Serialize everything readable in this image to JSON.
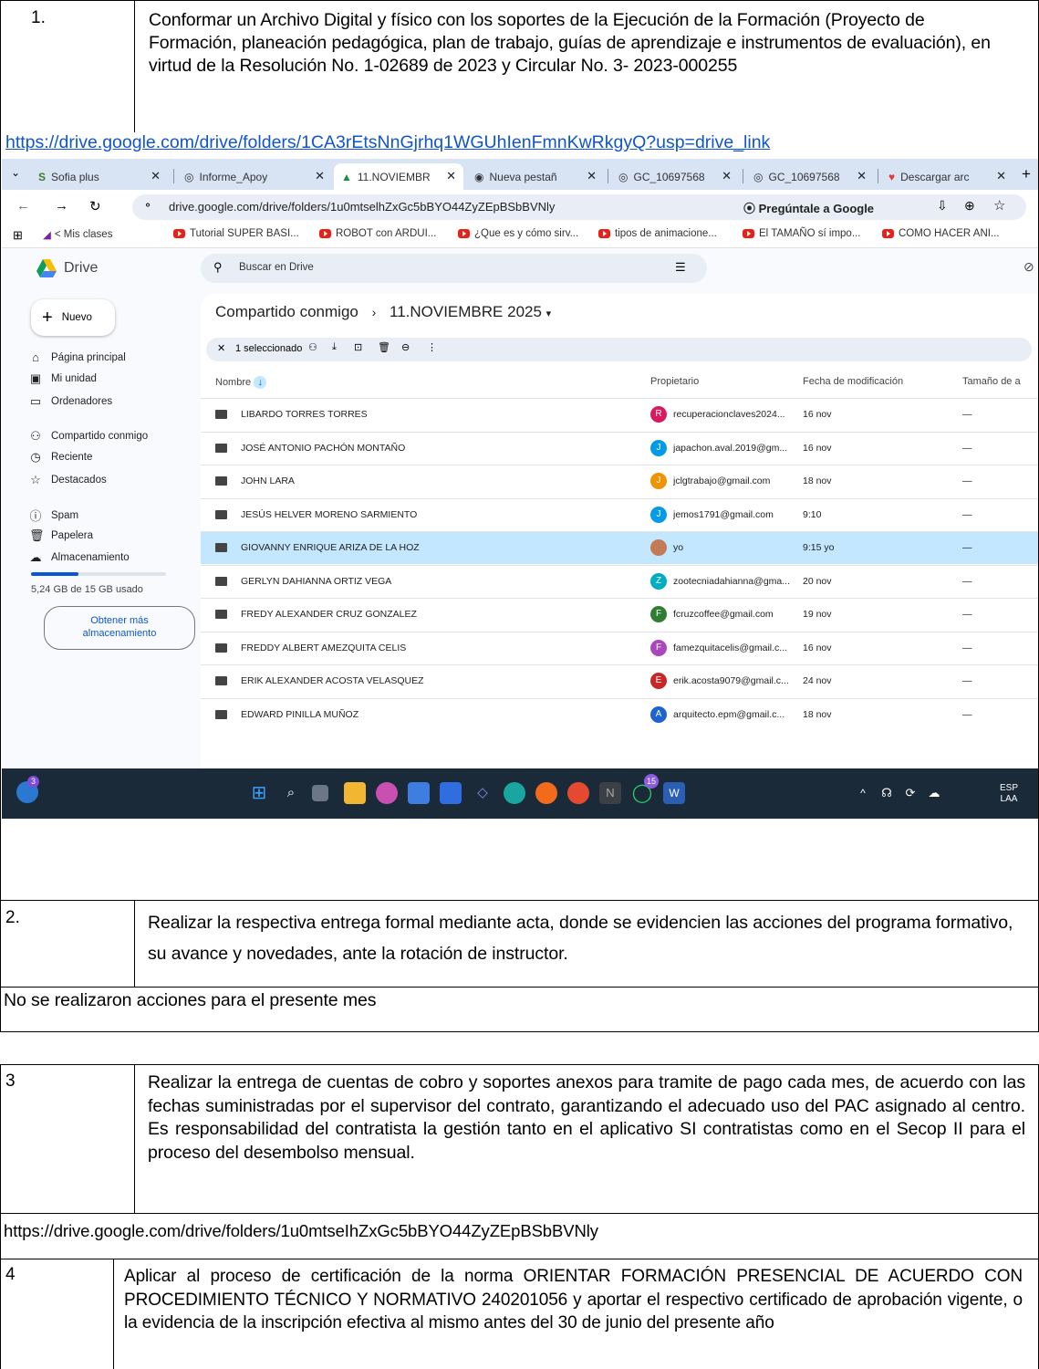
{
  "item1": {
    "num": "1.",
    "text": "Conformar un Archivo Digital y físico con los soportes de la Ejecución de la Formación (Proyecto de Formación, planeación pedagógica, plan de trabajo, guías de aprendizaje e instrumentos de evaluación), en virtud de la Resolución No. 1-02689 de 2023 y Circular No. 3- 2023-000255",
    "link": "https://drive.google.com/drive/folders/1CA3rEtsNnGjrhq1WGUhIenFmnKwRkgyQ?usp=drive_link"
  },
  "browser": {
    "tabs": [
      "Sofia plus",
      "Informe_Apoy",
      "11.NOVIEMBR",
      "Nueva pestañ",
      "GC_10697568",
      "GC_10697568",
      "Descargar arc"
    ],
    "url": "drive.google.com/drive/folders/1u0mtselhZxGc5bBYO44ZyZEpBSbBVNly",
    "ask_google": "Pregúntale a Google",
    "bookmarks": [
      "< Mis clases",
      "Tutorial SUPER BASI...",
      "ROBOT con ARDUI...",
      "¿Que es y cómo sirv...",
      "tipos de animacione...",
      "El TAMAÑO sí impo...",
      "COMO HACER ANI..."
    ]
  },
  "drive": {
    "app": "Drive",
    "search_placeholder": "Buscar en Drive",
    "new_label": "Nuevo",
    "nav": [
      "Página principal",
      "Mi unidad",
      "Ordenadores",
      "Compartido conmigo",
      "Reciente",
      "Destacados",
      "Spam",
      "Papelera",
      "Almacenamiento"
    ],
    "storage": "5,24 GB de 15 GB usado",
    "get_more": "Obtener más almacenamiento",
    "breadcrumb_root": "Compartido conmigo",
    "breadcrumb_current": "11.NOVIEMBRE 2025",
    "selected": "1 seleccionado",
    "columns": {
      "name": "Nombre",
      "owner": "Propietario",
      "modified": "Fecha de modificación",
      "size": "Tamaño de a"
    },
    "rows": [
      {
        "name": "LIBARDO TORRES TORRES",
        "initial": "R",
        "color": "#d81b60",
        "owner": "recuperacionclaves2024...",
        "date": "16 nov",
        "size": "—"
      },
      {
        "name": "JOSÉ ANTONIO PACHÓN MONTAÑO",
        "initial": "J",
        "color": "#039be5",
        "owner": "japachon.aval.2019@gm...",
        "date": "16 nov",
        "size": "—"
      },
      {
        "name": "JOHN LARA",
        "initial": "J",
        "color": "#f09300",
        "owner": "jclgtrabajo@gmail.com",
        "date": "18 nov",
        "size": "—"
      },
      {
        "name": "JESÚS HELVER MORENO SARMIENTO",
        "initial": "J",
        "color": "#039be5",
        "owner": "jemos1791@gmail.com",
        "date": "9:10",
        "size": "—"
      },
      {
        "name": "GIOVANNY ENRIQUE ARIZA DE LA HOZ",
        "initial": "",
        "color": "#c47a55",
        "owner": "yo",
        "date": "9:15 yo",
        "size": "—"
      },
      {
        "name": "GERLYN DAHIANNA ORTIZ VEGA",
        "initial": "Z",
        "color": "#00acc1",
        "owner": "zootecniadahianna@gma...",
        "date": "20 nov",
        "size": "—"
      },
      {
        "name": "FREDY ALEXANDER CRUZ GONZALEZ",
        "initial": "F",
        "color": "#2e7d32",
        "owner": "fcruzcoffee@gmail.com",
        "date": "19 nov",
        "size": "—"
      },
      {
        "name": "FREDDY ALBERT AMEZQUITA CELIS",
        "initial": "F",
        "color": "#ab47bc",
        "owner": "famezquitacelis@gmail.c...",
        "date": "16 nov",
        "size": "—"
      },
      {
        "name": "ERIK ALEXANDER ACOSTA VELASQUEZ",
        "initial": "E",
        "color": "#c62828",
        "owner": "erik.acosta9079@gmail.c...",
        "date": "24 nov",
        "size": "—"
      },
      {
        "name": "EDWARD PINILLA MUÑOZ",
        "initial": "A",
        "color": "#1e63d0",
        "owner": "arquitecto.epm@gmail.c...",
        "date": "18 nov",
        "size": "—"
      }
    ]
  },
  "taskbar": {
    "notif_count": "3",
    "whatsapp_count": "15",
    "lang": "ESP",
    "layout": "LAA"
  },
  "item2": {
    "num": "2.",
    "text": "Realizar la respectiva entrega formal mediante acta, donde se evidencien las acciones del programa formativo, su avance y novedades, ante la rotación de instructor.",
    "note": "No se realizaron acciones para el presente mes"
  },
  "item3": {
    "num": "3",
    "text": "Realizar la entrega de cuentas de cobro y soportes anexos para tramite de pago cada mes, de acuerdo con las fechas suministradas por el supervisor del contrato, garantizando el adecuado uso del PAC asignado al centro. Es responsabilidad del contratista la gestión tanto en el aplicativo SI contratistas como en el Secop II para el proceso del desembolso mensual.",
    "link": "https://drive.google.com/drive/folders/1u0mtseIhZxGc5bBYO44ZyZEpBSbBVNly"
  },
  "item4": {
    "num": "4",
    "text": "Aplicar al proceso de certificación de la norma ORIENTAR FORMACIÓN PRESENCIAL DE ACUERDO CON PROCEDIMIENTO TÉCNICO Y NORMATIVO 240201056 y aportar el respectivo certificado de aprobación vigente, o la evidencia de la inscripción efectiva al mismo antes del 30 de junio del presente año"
  }
}
